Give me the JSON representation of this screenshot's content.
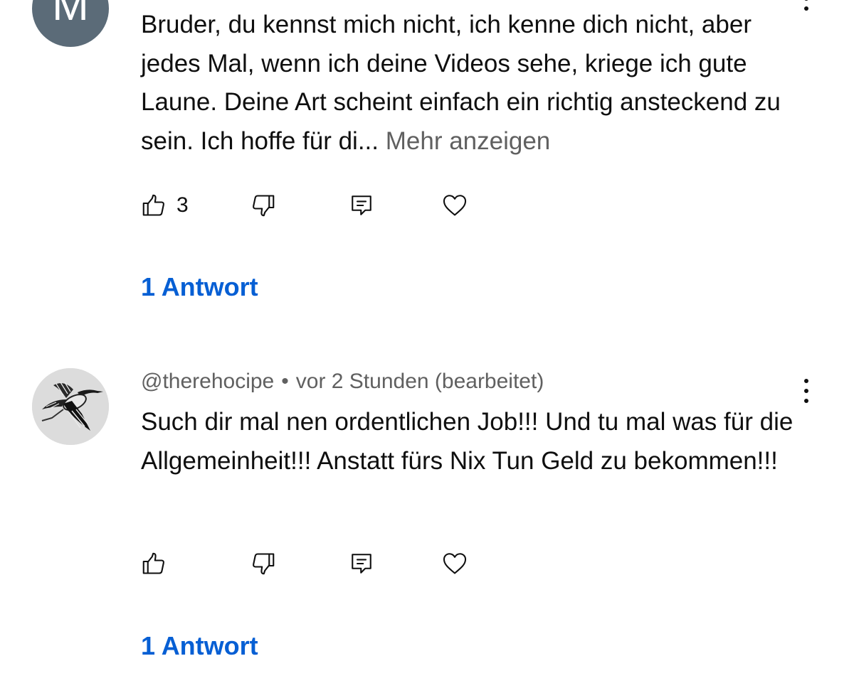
{
  "comments": [
    {
      "avatar_letter": "M",
      "avatar_color": "#5b6b78",
      "text": "Bruder, du kennst mich nicht, ich kenne dich nicht, aber jedes Mal, wenn ich deine Videos sehe, kriege ich gute Laune. Deine Art scheint einfach ein richtig ansteckend zu sein. Ich hoffe für di...",
      "read_more_label": "Mehr anzeigen",
      "like_count": "3",
      "replies_label": "1 Antwort",
      "icons": [
        "thumbs-up-icon",
        "thumbs-down-icon",
        "reply-icon",
        "heart-icon",
        "more-vertical-icon"
      ]
    },
    {
      "author": "@therehocipe",
      "separator": "•",
      "timestamp": "vor 2 Stunden (bearbeitet)",
      "avatar_image": "flying-stork-drawing",
      "text": "Such dir mal nen ordentlichen Job!!! Und tu mal was für die Allgemeinheit!!! Anstatt fürs Nix Tun Geld zu bekommen!!!",
      "replies_label": "1 Antwort",
      "icons": [
        "thumbs-up-icon",
        "thumbs-down-icon",
        "reply-icon",
        "heart-icon",
        "more-vertical-icon"
      ]
    }
  ],
  "colors": {
    "link": "#065fd4",
    "secondary_text": "#606060",
    "primary_text": "#0f0f0f",
    "background": "#ffffff"
  }
}
